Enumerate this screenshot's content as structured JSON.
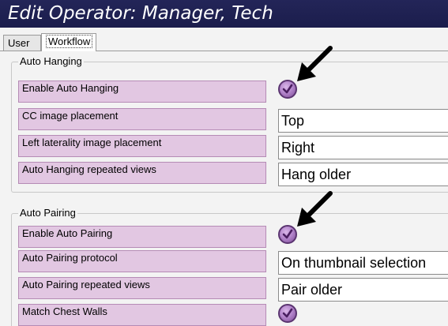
{
  "window": {
    "title": "Edit Operator: Manager, Tech"
  },
  "tabs": [
    {
      "label": "User"
    },
    {
      "label": "Workflow"
    }
  ],
  "auto_hanging": {
    "group_title": "Auto Hanging",
    "rows": [
      {
        "label": "Enable Auto Hanging",
        "type": "checkbox",
        "checked": true
      },
      {
        "label": "CC image placement",
        "type": "select",
        "value": "Top"
      },
      {
        "label": "Left laterality image placement",
        "type": "select",
        "value": "Right"
      },
      {
        "label": "Auto Hanging repeated views",
        "type": "select",
        "value": "Hang older"
      }
    ]
  },
  "auto_pairing": {
    "group_title": "Auto Pairing",
    "rows": [
      {
        "label": "Enable Auto Pairing",
        "type": "checkbox",
        "checked": true
      },
      {
        "label": "Auto Pairing protocol",
        "type": "select",
        "value": "On thumbnail selection"
      },
      {
        "label": "Auto Pairing repeated views",
        "type": "select",
        "value": "Pair older"
      },
      {
        "label": "Match Chest Walls",
        "type": "checkbox",
        "checked": true
      }
    ]
  },
  "colors": {
    "titlebar": "#232558",
    "label_fill": "#e2c7e2",
    "checkbox": "#b486cc"
  },
  "icons": {
    "check": "checkmark-icon",
    "callout": "arrow-pointer-icon"
  }
}
